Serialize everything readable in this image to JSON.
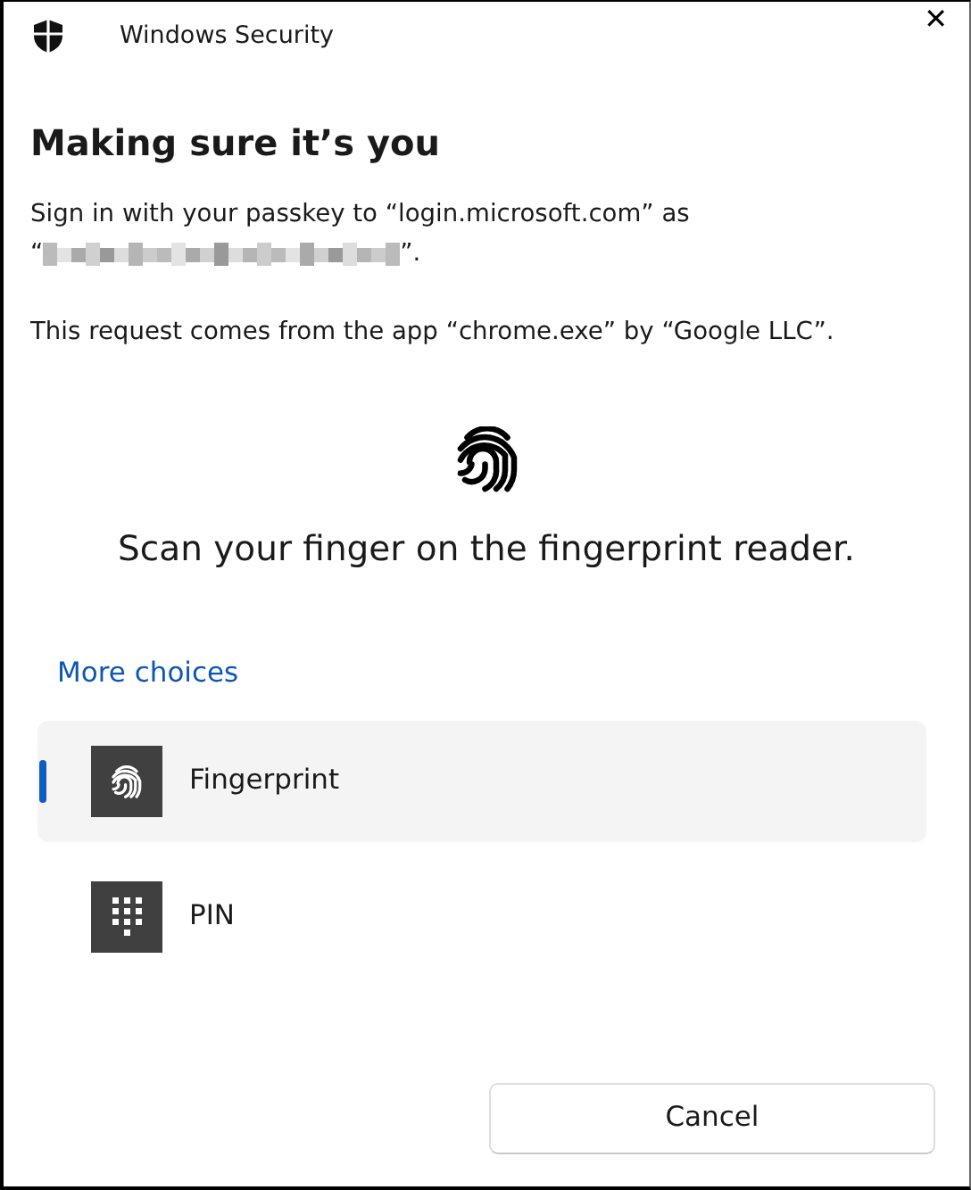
{
  "window": {
    "title": "Windows Security",
    "close": "✕"
  },
  "heading": "Making sure it’s you",
  "sign_in": {
    "text": "Sign in with your passkey to “login.microsoft.com” as",
    "open_quote": "“",
    "account_redacted": true,
    "close_quote": "”."
  },
  "request_text": "This request comes from the app “chrome.exe” by “Google LLC”.",
  "prompt": "Scan your finger on the fingerprint reader.",
  "more_choices": "More choices",
  "options": [
    {
      "kind": "fingerprint",
      "label": "Fingerprint",
      "selected": true
    },
    {
      "kind": "pin",
      "label": "PIN",
      "selected": false
    }
  ],
  "buttons": [
    {
      "label": "Cancel"
    }
  ]
}
